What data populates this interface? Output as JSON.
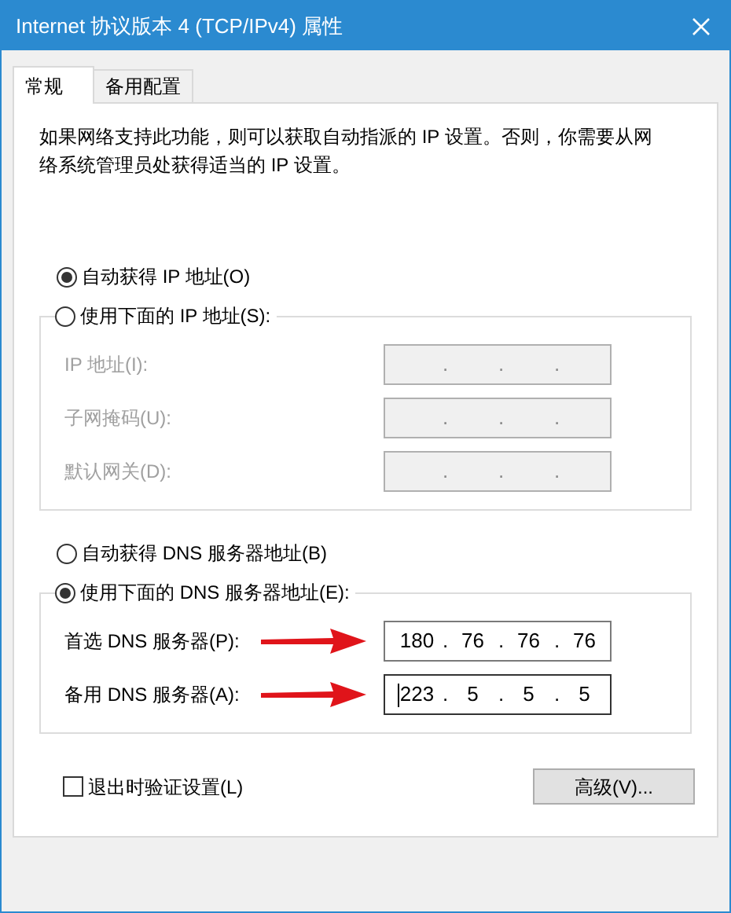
{
  "window": {
    "title": "Internet 协议版本 4 (TCP/IPv4) 属性"
  },
  "tabs": [
    {
      "label": "常规",
      "selected": true
    },
    {
      "label": "备用配置",
      "selected": false
    }
  ],
  "description": "如果网络支持此功能，则可以获取自动指派的 IP 设置。否则，你需要从网络系统管理员处获得适当的 IP 设置。",
  "ip_section": {
    "auto_option": {
      "label": "自动获得 IP 地址(O)",
      "selected": true
    },
    "manual_option": {
      "label": "使用下面的 IP 地址(S):",
      "selected": false
    },
    "disabled": true,
    "fields": [
      {
        "label": "IP 地址(I):",
        "dots": [
          ".",
          ".",
          "."
        ]
      },
      {
        "label": "子网掩码(U):",
        "dots": [
          ".",
          ".",
          "."
        ]
      },
      {
        "label": "默认网关(D):",
        "dots": [
          ".",
          ".",
          "."
        ]
      }
    ]
  },
  "dns_section": {
    "auto_option": {
      "label": "自动获得 DNS 服务器地址(B)",
      "selected": false
    },
    "manual_option": {
      "label": "使用下面的 DNS 服务器地址(E):",
      "selected": true
    },
    "disabled": false,
    "fields": [
      {
        "label": "首选 DNS 服务器(P):",
        "octets": [
          "180",
          "76",
          "76",
          "76"
        ],
        "dots": [
          ".",
          ".",
          "."
        ],
        "annotated": true,
        "focused": false
      },
      {
        "label": "备用 DNS 服务器(A):",
        "octets": [
          "223",
          "5",
          "5",
          "5"
        ],
        "dots": [
          ".",
          ".",
          "."
        ],
        "annotated": true,
        "focused": true
      }
    ]
  },
  "verify_on_exit": {
    "label": "退出时验证设置(L)",
    "checked": false
  },
  "advanced_button": {
    "label": "高级(V)..."
  }
}
